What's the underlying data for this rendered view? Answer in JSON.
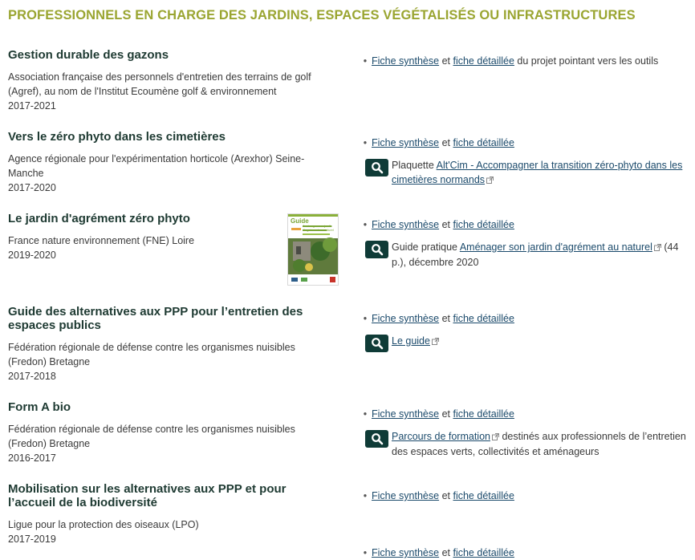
{
  "section_title": "PROFESSIONNELS EN CHARGE DES JARDINS, ESPACES VÉGÉTALISÉS OU INFRASTRUCTURES",
  "icons": {
    "search": "search-icon",
    "external": "external-link-icon"
  },
  "colors": {
    "section_title": "#9aa531",
    "project_title": "#1e3a32",
    "link": "#1b4a6b",
    "badge": "#0f3b37"
  },
  "projects": [
    {
      "title": "Gestion durable des gazons",
      "org": "Association française des personnels d'entretien des terrains de golf (Agref), au nom de l'Institut Ecoumène golf & environnement",
      "years": "2017-2021",
      "fiche_synthese": "Fiche synthèse",
      "et": "et",
      "fiche_detaillee": "fiche détaillée",
      "suffix": "du projet pointant vers les outils"
    },
    {
      "title": "Vers le zéro phyto dans les cimetières",
      "org": "Agence régionale pour l'expérimentation horticole (Arexhor) Seine-Manche",
      "years": "2017-2020",
      "fiche_synthese": "Fiche synthèse",
      "et": "et",
      "fiche_detaillee": "fiche détaillée",
      "resource": {
        "prefix": "Plaquette",
        "link": "Alt'Cim - Accompagner la transition zéro-phyto dans les cimetières normands"
      }
    },
    {
      "title": "Le jardin d'agrément zéro phyto",
      "org": "France nature environnement (FNE) Loire",
      "years": "2019-2020",
      "fiche_synthese": "Fiche synthèse",
      "et": "et",
      "fiche_detaillee": "fiche détaillée",
      "thumbnail": {
        "label": "Guide",
        "subtitle": "Aménager son jardin d'agrément au naturel"
      },
      "resource": {
        "prefix": "Guide pratique",
        "link": "Aménager son jardin d'agrément au naturel",
        "suffix": "(44 p.), décembre 2020"
      }
    },
    {
      "title": "Guide des alternatives aux PPP pour l’entretien des espaces publics",
      "org": "Fédération régionale de défense contre les organismes nuisibles (Fredon) Bretagne",
      "years": "2017-2018",
      "fiche_synthese": "Fiche synthèse",
      "et": "et",
      "fiche_detaillee": "fiche détaillée",
      "resource": {
        "link": "Le guide"
      }
    },
    {
      "title": "Form A bio",
      "org": "Fédération régionale de défense contre les organismes nuisibles (Fredon) Bretagne",
      "years": "2016-2017",
      "fiche_synthese": "Fiche synthèse",
      "et": "et",
      "fiche_detaillee": "fiche détaillée",
      "resource": {
        "link": "Parcours de formation",
        "suffix": "destinés aux professionnels de l’entretien des espaces verts, collectivités et aménageurs"
      }
    },
    {
      "title": "Mobilisation sur les alternatives aux PPP et pour l’accueil de la biodiversité",
      "org": "Ligue pour la protection des oiseaux (LPO)",
      "years": "2017-2019",
      "fiche_synthese": "Fiche synthèse",
      "et": "et",
      "fiche_detaillee": "fiche détaillée"
    },
    {
      "fiche_synthese": "Fiche synthèse",
      "et": "et",
      "fiche_detaillee": "fiche détaillée"
    }
  ]
}
